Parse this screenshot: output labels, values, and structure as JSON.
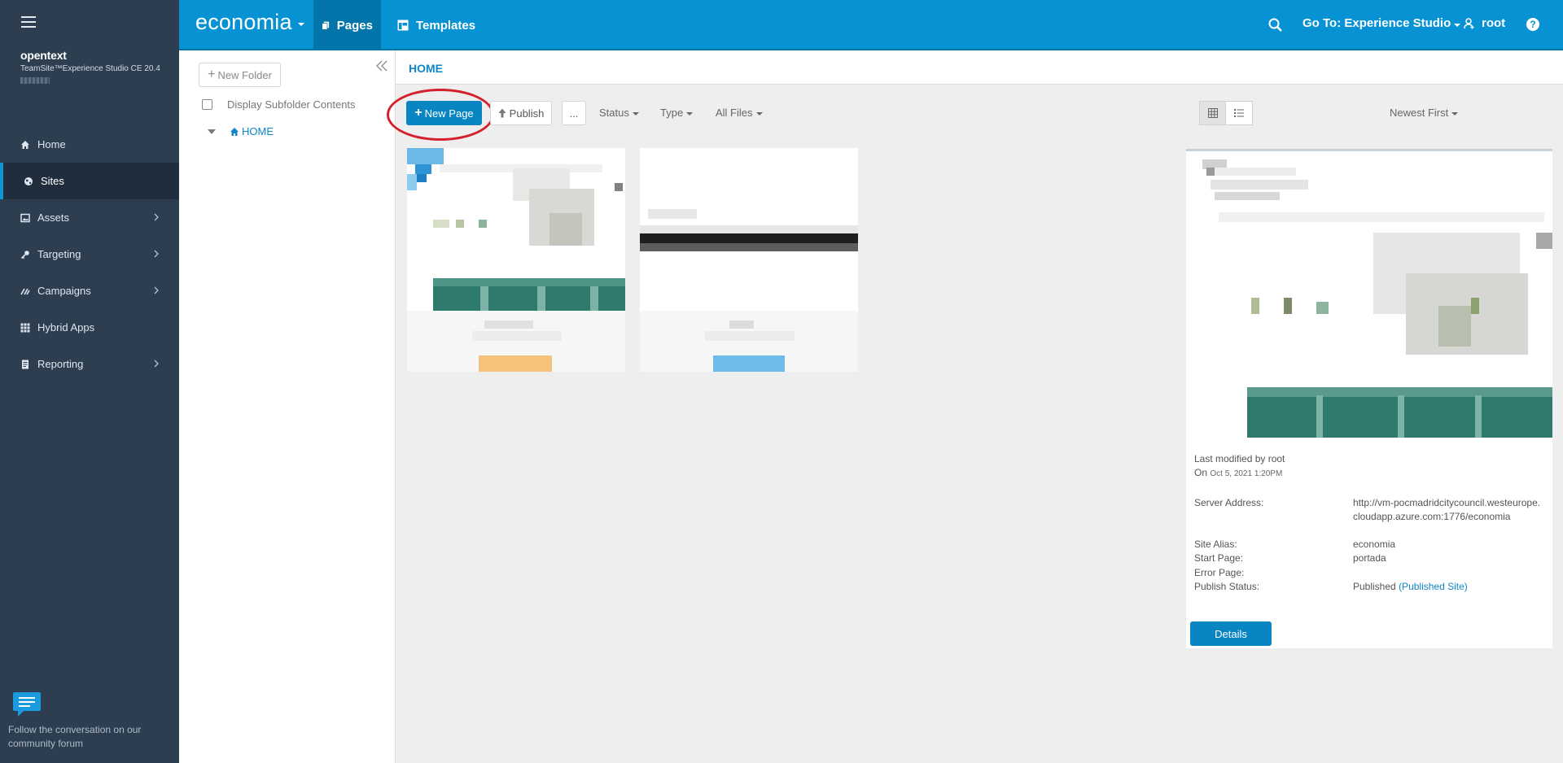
{
  "sidebar": {
    "brand_line1": "opentext",
    "brand_line2": "TeamSite™Experience Studio CE 20.4",
    "items": [
      {
        "label": "Home",
        "icon": "home-icon"
      },
      {
        "label": "Sites",
        "icon": "globe-icon",
        "active": true
      },
      {
        "label": "Assets",
        "icon": "image-icon",
        "has_children": true
      },
      {
        "label": "Targeting",
        "icon": "key-icon",
        "has_children": true
      },
      {
        "label": "Campaigns",
        "icon": "campaign-icon",
        "has_children": true
      },
      {
        "label": "Hybrid Apps",
        "icon": "grid-icon"
      },
      {
        "label": "Reporting",
        "icon": "report-icon",
        "has_children": true
      }
    ],
    "forum_text": "Follow the conversation on our community forum"
  },
  "topbar": {
    "site_name": "economia",
    "tabs": [
      {
        "label": "Pages",
        "icon": "pages-icon",
        "active": true
      },
      {
        "label": "Templates",
        "icon": "templates-icon"
      }
    ],
    "goto_label": "Go To: Experience Studio",
    "user_label": "root",
    "help_label": "?"
  },
  "folder_panel": {
    "new_folder_label": "New Folder",
    "subfolder_label": "Display Subfolder Contents",
    "tree_root": "HOME"
  },
  "breadcrumb": "HOME",
  "toolbar": {
    "new_page_label": "New Page",
    "publish_label": "Publish",
    "more_label": "...",
    "status_label": "Status",
    "type_label": "Type",
    "all_files_label": "All Files",
    "sort_label": "Newest First"
  },
  "details": {
    "modified_by": "Last modified by root",
    "modified_on_prefix": "On",
    "modified_on": "Oct 5, 2021 1:20PM",
    "fields": [
      {
        "key": "Server Address:",
        "value": "http://vm-pocmadridcitycouncil.westeurope.cloudapp.azure.com:1776/economia"
      },
      {
        "key": "Site Alias:",
        "value": "economia"
      },
      {
        "key": "Start Page:",
        "value": "portada"
      },
      {
        "key": "Error Page:",
        "value": ""
      },
      {
        "key": "Publish Status:",
        "value": "Published",
        "link": "(Published Site)"
      }
    ],
    "details_button": "Details"
  },
  "colors": {
    "topbar": "#0792d3",
    "sidebar": "#2c3e50",
    "primary_button": "#0a85c4",
    "highlight_ring": "#d4202a",
    "link": "#0f86c7"
  }
}
